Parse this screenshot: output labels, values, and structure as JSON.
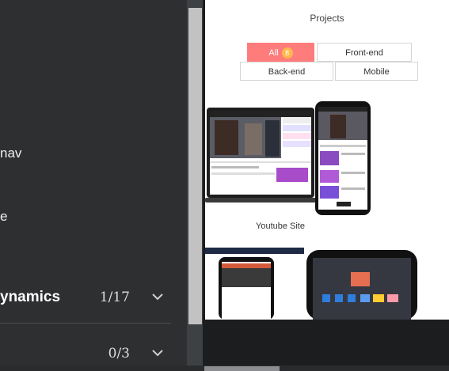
{
  "sidebar": {
    "partial_items": [
      {
        "text": "nav"
      },
      {
        "text": "e"
      }
    ],
    "sections": [
      {
        "title": "ynamics",
        "progress": "1/17"
      },
      {
        "title": "",
        "progress": "0/3"
      }
    ]
  },
  "preview": {
    "subtitle": "Projects",
    "filters": [
      {
        "label": "All",
        "badge": "8",
        "active": true
      },
      {
        "label": "Front-end",
        "active": false
      },
      {
        "label": "Back-end",
        "active": false
      },
      {
        "label": "Mobile",
        "active": false
      }
    ],
    "project_caption": "Youtube Site"
  },
  "colors": {
    "sidebar_bg": "#2d2f31",
    "active_filter": "#ff7c7c",
    "badge": "#ffb74d"
  }
}
